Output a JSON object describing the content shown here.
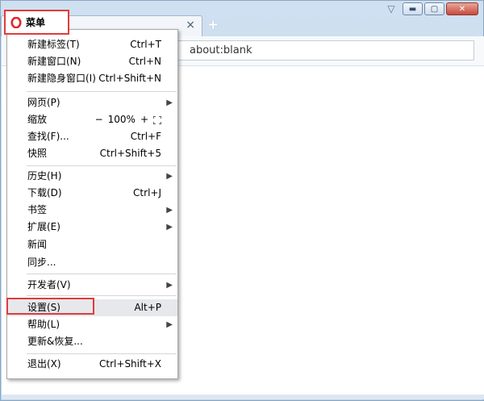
{
  "tab": {
    "close_glyph": "×"
  },
  "new_tab_glyph": "+",
  "address": {
    "value": "about:blank"
  },
  "menu_button": {
    "label": "菜单",
    "icon": "opera-logo-icon",
    "accent": "#e02a2a"
  },
  "menu": {
    "items": [
      {
        "id": "new-tab",
        "label": "新建标签(T)",
        "shortcut": "Ctrl+T"
      },
      {
        "id": "new-window",
        "label": "新建窗口(N)",
        "shortcut": "Ctrl+N"
      },
      {
        "id": "new-private",
        "label": "新建隐身窗口(I)",
        "shortcut": "Ctrl+Shift+N"
      },
      {
        "id": "page",
        "label": "网页(P)",
        "submenu": true
      },
      {
        "id": "zoom",
        "label": "缩放",
        "zoom": {
          "minus": "−",
          "value": "100%",
          "plus": "+",
          "fullscreen_icon": "fullscreen-icon"
        }
      },
      {
        "id": "find",
        "label": "查找(F)...",
        "shortcut": "Ctrl+F"
      },
      {
        "id": "snapshot",
        "label": "快照",
        "shortcut": "Ctrl+Shift+5"
      },
      {
        "id": "history",
        "label": "历史(H)",
        "submenu": true
      },
      {
        "id": "downloads",
        "label": "下载(D)",
        "shortcut": "Ctrl+J"
      },
      {
        "id": "bookmarks",
        "label": "书签",
        "submenu": true
      },
      {
        "id": "extensions",
        "label": "扩展(E)",
        "submenu": true
      },
      {
        "id": "news",
        "label": "新闻"
      },
      {
        "id": "sync",
        "label": "同步..."
      },
      {
        "id": "developer",
        "label": "开发者(V)",
        "submenu": true
      },
      {
        "id": "settings",
        "label": "设置(S)",
        "shortcut": "Alt+P",
        "highlighted": true
      },
      {
        "id": "help",
        "label": "帮助(L)",
        "submenu": true
      },
      {
        "id": "update",
        "label": "更新&恢复..."
      },
      {
        "id": "exit",
        "label": "退出(X)",
        "shortcut": "Ctrl+Shift+X"
      }
    ]
  }
}
